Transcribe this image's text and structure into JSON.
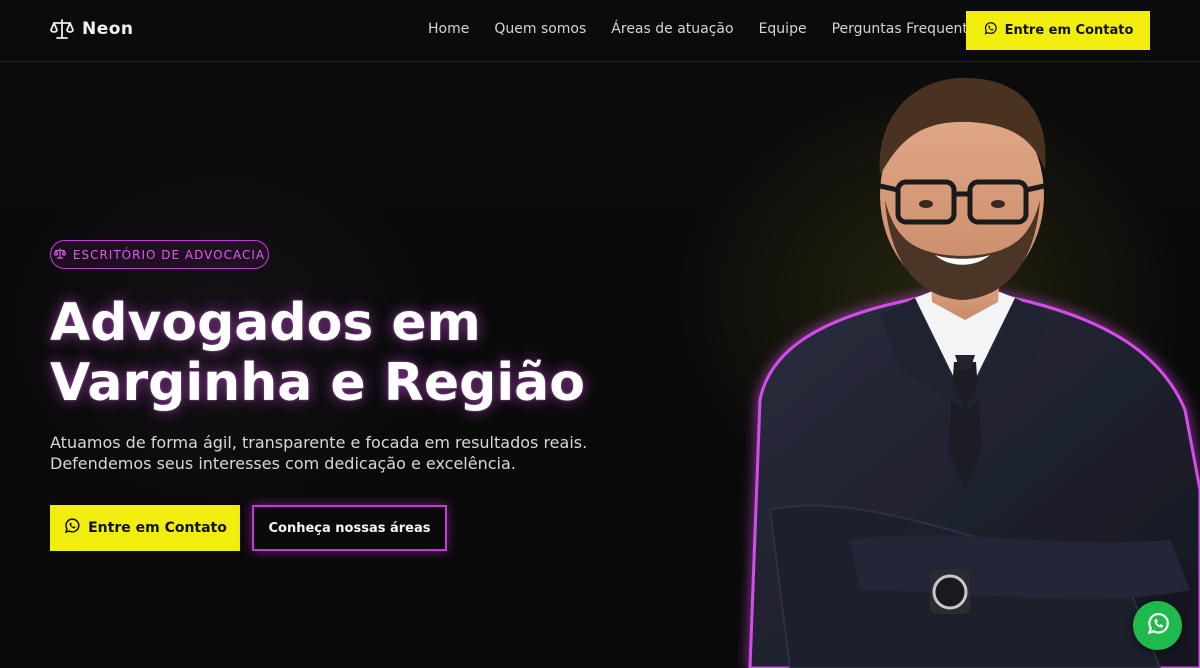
{
  "brand": {
    "name": "Neon",
    "icon": "scales-of-justice-icon"
  },
  "nav": {
    "items": [
      {
        "label": "Home"
      },
      {
        "label": "Quem somos"
      },
      {
        "label": "Áreas de atuação"
      },
      {
        "label": "Equipe"
      },
      {
        "label": "Perguntas Frequentes"
      }
    ],
    "cta_label": "Entre em Contato",
    "cta_icon": "whatsapp-icon"
  },
  "hero": {
    "badge": "ESCRITÓRIO DE ADVOCACIA",
    "badge_icon": "scales-icon",
    "title_line1": "Advogados em",
    "title_line2": "Varginha e Região",
    "subtitle_line1": "Atuamos de forma ágil, transparente e focada em resultados reais.",
    "subtitle_line2": "Defendemos seus interesses com dedicação e excelência.",
    "primary_cta": "Entre em Contato",
    "secondary_cta": "Conheça nossas áreas"
  },
  "floating": {
    "icon": "whatsapp-icon"
  },
  "colors": {
    "accent_yellow": "#f1ee0e",
    "accent_magenta": "#c23bd8",
    "background": "#0b0a0b",
    "whatsapp_green": "#1fba4c"
  }
}
